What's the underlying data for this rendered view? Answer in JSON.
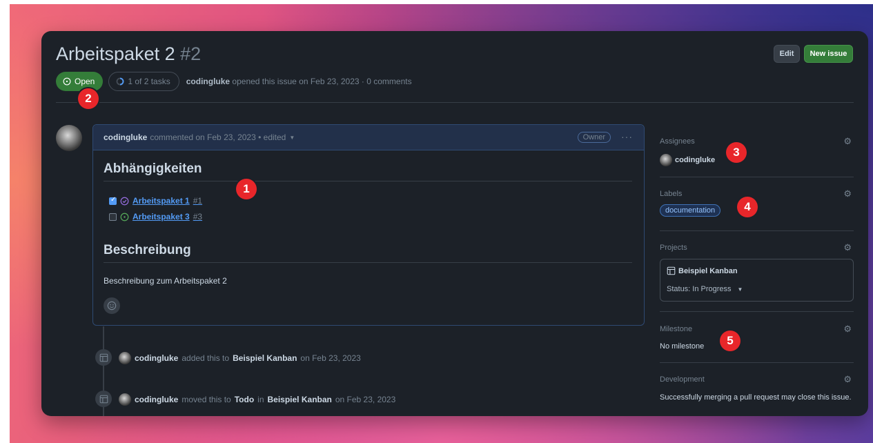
{
  "issue": {
    "title": "Arbeitspaket 2",
    "number": "#2",
    "state": "Open",
    "tasks": "1 of 2 tasks",
    "author": "codingluke",
    "opened_text": "opened this issue on Feb 23, 2023 · 0 comments"
  },
  "header": {
    "edit_label": "Edit",
    "new_issue_label": "New issue"
  },
  "comment": {
    "author": "codingluke",
    "meta": "commented on Feb 23, 2023 • edited",
    "owner_badge": "Owner",
    "heading_dependencies": "Abhängigkeiten",
    "tasks": [
      {
        "checked": true,
        "title": "Arbeitspaket 1",
        "number": "#1",
        "state_icon": "closed-issue-icon"
      },
      {
        "checked": false,
        "title": "Arbeitspaket 3",
        "number": "#3",
        "state_icon": "open-issue-icon"
      }
    ],
    "heading_description": "Beschreibung",
    "body": "Beschreibung zum Arbeitspaket 2"
  },
  "timeline": [
    {
      "user": "codingluke",
      "pre": "added this to",
      "project": "Beispiel Kanban",
      "post": "on Feb 23, 2023"
    },
    {
      "user": "codingluke",
      "pre": "moved this to",
      "column": "Todo",
      "mid": "in",
      "project": "Beispiel Kanban",
      "post": "on Feb 23, 2023"
    }
  ],
  "sidebar": {
    "assignees": {
      "title": "Assignees",
      "value": "codingluke"
    },
    "labels": {
      "title": "Labels",
      "value": "documentation"
    },
    "projects": {
      "title": "Projects",
      "project": "Beispiel Kanban",
      "status": "Status: In Progress"
    },
    "milestone": {
      "title": "Milestone",
      "value": "No milestone"
    },
    "development": {
      "title": "Development",
      "value": "Successfully merging a pull request may close this issue."
    }
  },
  "markers": [
    "1",
    "2",
    "3",
    "4",
    "5"
  ],
  "colors": {
    "open_green": "#347d39",
    "link_blue": "#539bf5",
    "marker_red": "#e8262a",
    "panel_bg": "#1c2128"
  }
}
